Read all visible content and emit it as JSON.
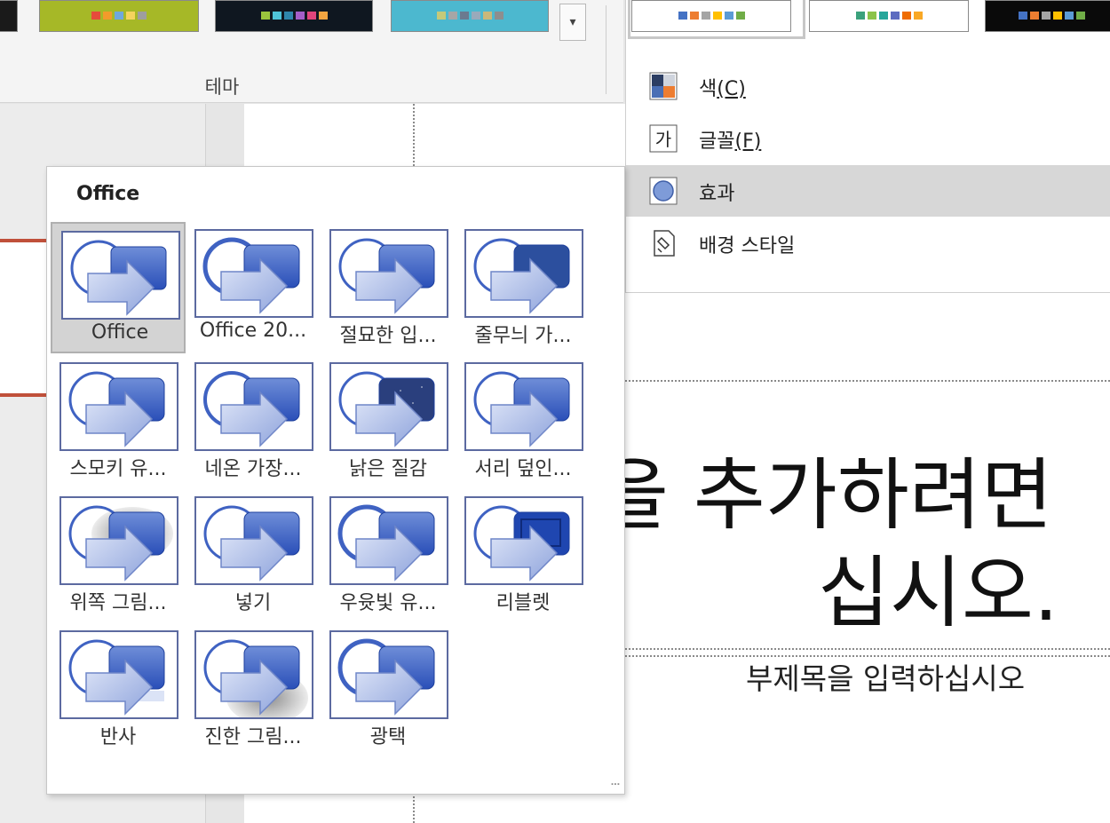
{
  "ribbon": {
    "group_label": "테마",
    "more_button_label": "▾",
    "theme_thumbnails": [
      {
        "name": "dark-theme-partial",
        "bg": "#1a1a1a",
        "swatches": []
      },
      {
        "name": "green-theme",
        "bg": "#a6b827",
        "swatches": [
          "#e64b3b",
          "#f39b2b",
          "#6fa8dc",
          "#f4d35e",
          "#9e9e9e"
        ]
      },
      {
        "name": "dark-navy-theme",
        "bg": "#0f1720",
        "swatches": [
          "#9bc53d",
          "#4fc3d8",
          "#2e86ab",
          "#a45ec8",
          "#e0457b",
          "#f2a541"
        ]
      },
      {
        "name": "teal-theme",
        "bg": "#4cb8cf",
        "swatches": [
          "#c5c97a",
          "#a6a6a6",
          "#6b7a8f",
          "#9ab",
          "#c9b87a",
          "#8e8e8e"
        ]
      }
    ]
  },
  "theme_menu": {
    "variants": [
      {
        "name": "office-variant",
        "bg": "#ffffff",
        "swatches": [
          "#4472c4",
          "#ed7d31",
          "#a5a5a5",
          "#ffc000",
          "#5b9bd5",
          "#70ad47"
        ]
      },
      {
        "name": "green-variant",
        "bg": "#ffffff",
        "swatches": [
          "#3ba17c",
          "#8bc34a",
          "#26a69a",
          "#5c6bc0",
          "#ef6c00",
          "#f9a825"
        ]
      },
      {
        "name": "dark-variant",
        "bg": "#0a0a0a",
        "swatches": [
          "#4472c4",
          "#ed7d31",
          "#a5a5a5",
          "#ffc000",
          "#5b9bd5",
          "#70ad47"
        ]
      }
    ],
    "items": [
      {
        "name": "colors",
        "label": "색",
        "accel": "(C)"
      },
      {
        "name": "fonts",
        "label": "글꼴",
        "accel": "(F)"
      },
      {
        "name": "effects",
        "label": "효과",
        "accel": ""
      },
      {
        "name": "background-styles",
        "label": "배경 스타일",
        "accel": ""
      }
    ]
  },
  "effects_popup": {
    "header": "Office",
    "items": [
      {
        "label": "Office",
        "style": "plain",
        "selected": true
      },
      {
        "label": "Office 20...",
        "style": "bevel"
      },
      {
        "label": "절묘한 입...",
        "style": "subtle"
      },
      {
        "label": "줄무늬 가...",
        "style": "banded"
      },
      {
        "label": "스모키 유...",
        "style": "smoky"
      },
      {
        "label": "네온 가장...",
        "style": "neon"
      },
      {
        "label": "낡은 질감",
        "style": "grunge"
      },
      {
        "label": "서리 덮인...",
        "style": "frosted"
      },
      {
        "label": "위쪽 그림...",
        "style": "topshadow"
      },
      {
        "label": "넣기",
        "style": "inset"
      },
      {
        "label": "우윳빛 유...",
        "style": "milky"
      },
      {
        "label": "리블렛",
        "style": "riblet"
      },
      {
        "label": "반사",
        "style": "reflection"
      },
      {
        "label": "진한 그림...",
        "style": "extremeshadow"
      },
      {
        "label": "광택",
        "style": "glossy"
      }
    ]
  },
  "slide": {
    "title_line1": "을 추가하려면",
    "title_line2": "십시오.",
    "subtitle": "부제목을 입력하십시오"
  },
  "colors": {
    "accent_red": "#c0503a",
    "effect_blue_dark": "#2a4fb8",
    "effect_blue_light": "#6f8ed8",
    "menu_hover": "#d7d7d7"
  }
}
